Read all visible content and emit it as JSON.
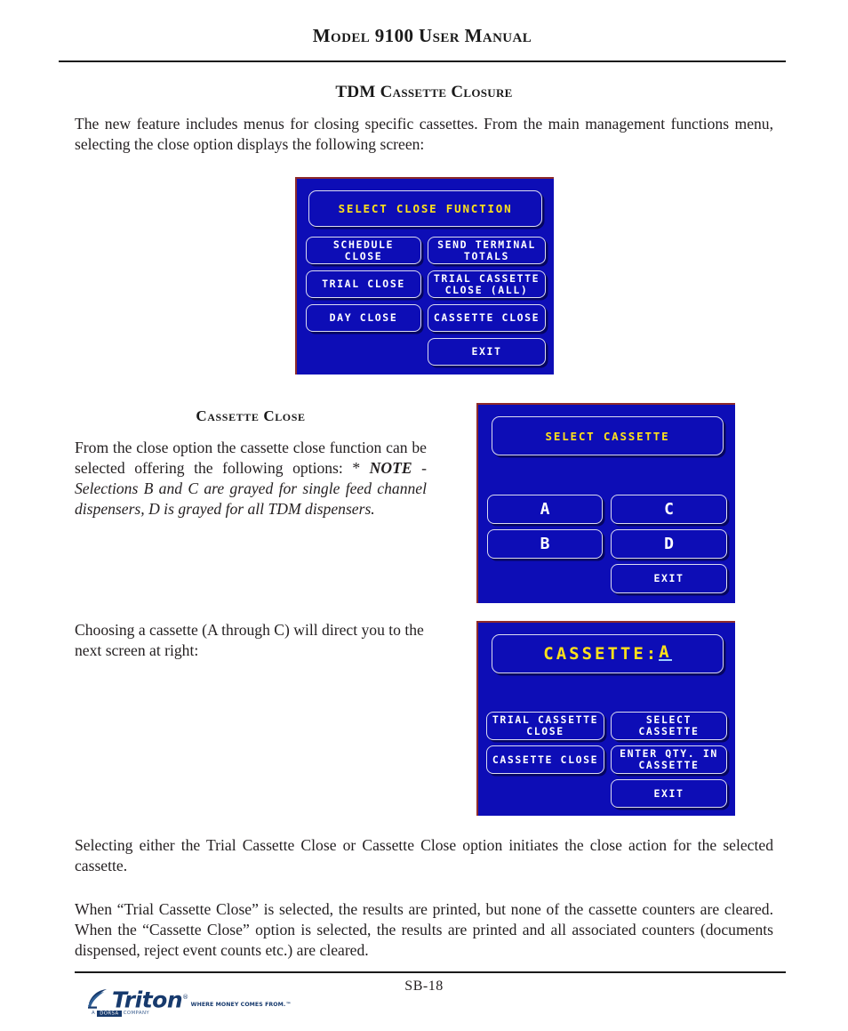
{
  "header": {
    "title": "Model 9100 User Manual"
  },
  "sections": {
    "tdm_title": "TDM Cassette Closure",
    "cassette_close_title": "Cassette  Close"
  },
  "paragraphs": {
    "intro": "The new feature includes menus for closing specific cassettes.  From the main management functions menu, selecting the close option displays the following screen:",
    "close_option_lead": "From the close option the cassette close function can be selected offering the following options:  * ",
    "close_option_note_lead": "NOTE",
    "close_option_note_body": " - Selections B and C are grayed for single feed channel dispensers, D is grayed for all TDM dispensers.",
    "choosing": "Choosing a cassette (A through C) will direct you to the next screen at right:",
    "selecting": "Selecting either the Trial Cassette Close or Cassette Close option initiates the close action for the selected cassette.",
    "when_trial": "When “Trial Cassette Close” is selected, the results are printed, but none of the cassette counters are cleared.  When the “Cassette Close” option is selected, the results are printed and all associated counters (documents dispensed, reject event counts etc.) are cleared."
  },
  "screens": {
    "close_function": {
      "title": "SELECT CLOSE FUNCTION",
      "buttons": {
        "schedule_close": "SCHEDULE\nCLOSE",
        "send_terminal_totals": "SEND TERMINAL\nTOTALS",
        "trial_close": "TRIAL CLOSE",
        "trial_cassette_close_all": "TRIAL CASSETTE\nCLOSE (ALL)",
        "day_close": "DAY CLOSE",
        "cassette_close": "CASSETTE CLOSE",
        "exit": "EXIT"
      }
    },
    "select_cassette": {
      "title": "SELECT CASSETTE",
      "buttons": {
        "a": "A",
        "b": "B",
        "c": "C",
        "d": "D",
        "exit": "EXIT"
      }
    },
    "cassette_a": {
      "title_label": "CASSETTE:",
      "title_value": "A",
      "buttons": {
        "trial_cassette_close": "TRIAL CASSETTE\nCLOSE",
        "select_cassette": "SELECT\nCASSETTE",
        "cassette_close": "CASSETTE CLOSE",
        "enter_qty": "ENTER QTY. IN\nCASSETTE",
        "exit": "EXIT"
      }
    }
  },
  "colors": {
    "screen_background": "#0d0db6",
    "screen_title_text": "#ffe11a",
    "screen_button_text": "#ffffff",
    "screen_border": "#8e2b2b",
    "logo": "#173a6d"
  },
  "footer": {
    "page_number": "SB-18",
    "logo_word": "Triton",
    "logo_tagline": "WHERE MONEY COMES FROM.",
    "logo_subtext_prefix": "A",
    "logo_subtext_box": "DORSA",
    "logo_subtext_suffix": "COMPANY"
  }
}
